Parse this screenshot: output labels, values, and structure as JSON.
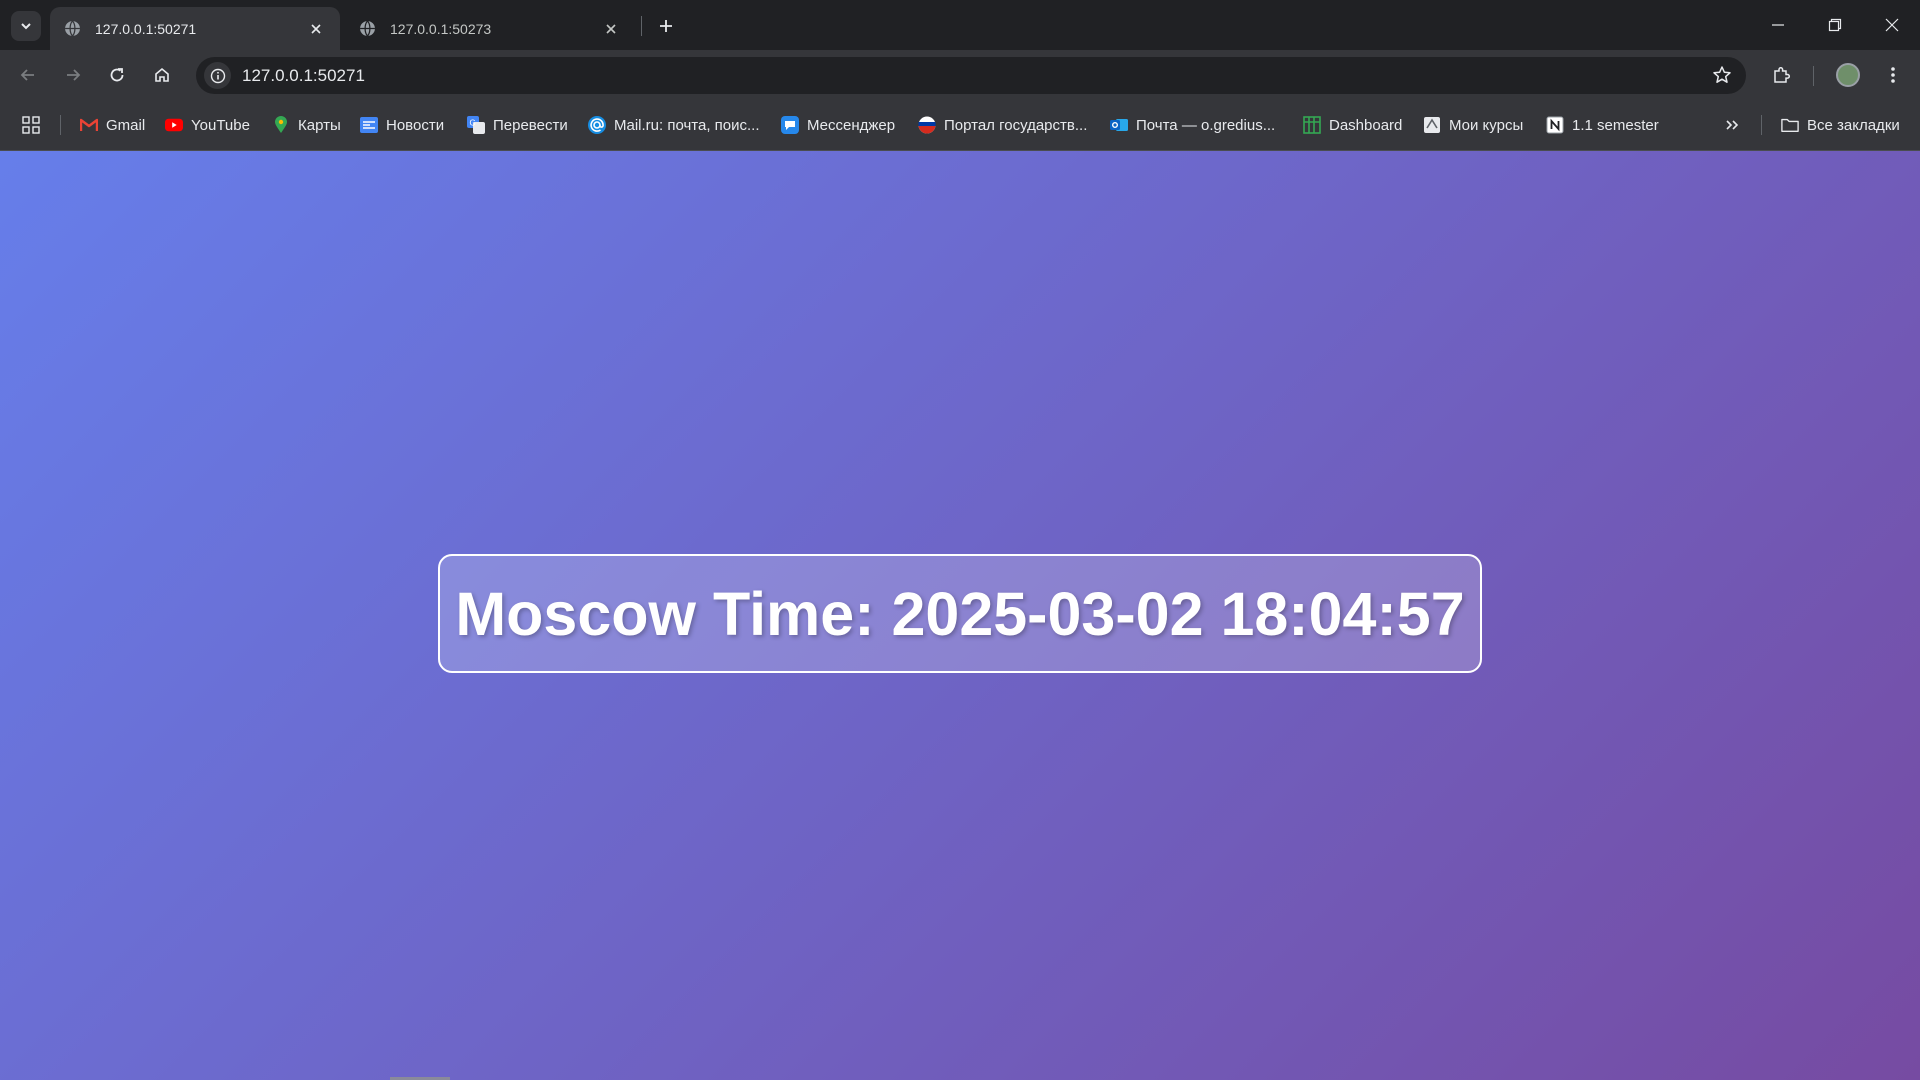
{
  "browser": {
    "tabs": [
      {
        "title": "127.0.0.1:50271",
        "active": true,
        "favicon": "globe-icon"
      },
      {
        "title": "127.0.0.1:50273",
        "active": false,
        "favicon": "globe-icon"
      }
    ],
    "address_bar": {
      "url": "127.0.0.1:50271"
    },
    "bookmarks": [
      {
        "label": "Gmail",
        "icon": "gmail-icon",
        "color": "#ea4335"
      },
      {
        "label": "YouTube",
        "icon": "youtube-icon",
        "color": "#ff0000"
      },
      {
        "label": "Карты",
        "icon": "maps-icon",
        "color": "#34a853"
      },
      {
        "label": "Новости",
        "icon": "news-icon",
        "color": "#4285f4"
      },
      {
        "label": "Перевести",
        "icon": "translate-icon",
        "color": "#4285f4"
      },
      {
        "label": "Mail.ru: почта, поис...",
        "icon": "mailru-icon",
        "color": "#168de2"
      },
      {
        "label": "Мессенджер",
        "icon": "messenger-icon",
        "color": "#2688eb"
      },
      {
        "label": "Портал государств...",
        "icon": "gosuslugi-icon",
        "color": "#d52b1e"
      },
      {
        "label": "Почта — o.gredius...",
        "icon": "outlook-icon",
        "color": "#0a64c5"
      },
      {
        "label": "Dashboard",
        "icon": "dashboard-icon",
        "color": "#34a853"
      },
      {
        "label": "Мои курсы",
        "icon": "courses-icon",
        "color": "#bdbdbd"
      },
      {
        "label": "1.1 semester",
        "icon": "notion-icon",
        "color": "#ffffff"
      }
    ],
    "all_bookmarks_label": "Все закладки"
  },
  "page": {
    "clock_text": "Moscow Time: 2025-03-02 18:04:57",
    "gradient": {
      "start": "#667eea",
      "end": "#764ba2"
    }
  }
}
